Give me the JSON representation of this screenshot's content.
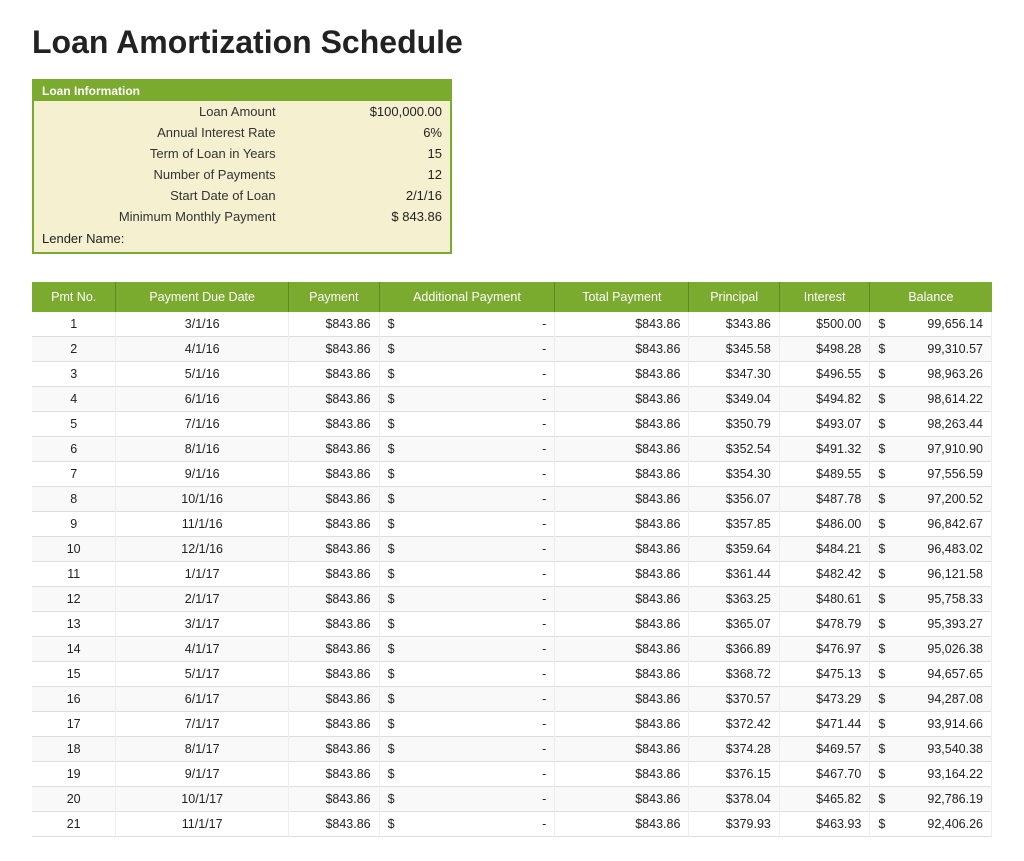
{
  "title": "Loan Amortization Schedule",
  "loanInfo": {
    "header": "Loan Information",
    "fields": [
      {
        "label": "Loan Amount",
        "value": "$100,000.00"
      },
      {
        "label": "Annual Interest Rate",
        "value": "6%"
      },
      {
        "label": "Term of Loan in Years",
        "value": "15"
      },
      {
        "label": "Number of Payments",
        "value": "12"
      },
      {
        "label": "Start Date of Loan",
        "value": "2/1/16"
      },
      {
        "label": "Minimum Monthly Payment",
        "value": "$ 843.86"
      }
    ],
    "lenderLabel": "Lender Name:"
  },
  "tableHeaders": [
    "Pmt No.",
    "Payment Due Date",
    "Payment",
    "Additional Payment",
    "Total Payment",
    "Principal",
    "Interest",
    "Balance"
  ],
  "rows": [
    {
      "pmt": 1,
      "date": "3/1/16",
      "payment": "$843.86",
      "addlDollar": "$",
      "addlAmt": "-",
      "totalPayment": "$843.86",
      "principal": "$343.86",
      "interest": "$500.00",
      "balDollar": "$",
      "balance": "99,656.14"
    },
    {
      "pmt": 2,
      "date": "4/1/16",
      "payment": "$843.86",
      "addlDollar": "$",
      "addlAmt": "-",
      "totalPayment": "$843.86",
      "principal": "$345.58",
      "interest": "$498.28",
      "balDollar": "$",
      "balance": "99,310.57"
    },
    {
      "pmt": 3,
      "date": "5/1/16",
      "payment": "$843.86",
      "addlDollar": "$",
      "addlAmt": "-",
      "totalPayment": "$843.86",
      "principal": "$347.30",
      "interest": "$496.55",
      "balDollar": "$",
      "balance": "98,963.26"
    },
    {
      "pmt": 4,
      "date": "6/1/16",
      "payment": "$843.86",
      "addlDollar": "$",
      "addlAmt": "-",
      "totalPayment": "$843.86",
      "principal": "$349.04",
      "interest": "$494.82",
      "balDollar": "$",
      "balance": "98,614.22"
    },
    {
      "pmt": 5,
      "date": "7/1/16",
      "payment": "$843.86",
      "addlDollar": "$",
      "addlAmt": "-",
      "totalPayment": "$843.86",
      "principal": "$350.79",
      "interest": "$493.07",
      "balDollar": "$",
      "balance": "98,263.44"
    },
    {
      "pmt": 6,
      "date": "8/1/16",
      "payment": "$843.86",
      "addlDollar": "$",
      "addlAmt": "-",
      "totalPayment": "$843.86",
      "principal": "$352.54",
      "interest": "$491.32",
      "balDollar": "$",
      "balance": "97,910.90"
    },
    {
      "pmt": 7,
      "date": "9/1/16",
      "payment": "$843.86",
      "addlDollar": "$",
      "addlAmt": "-",
      "totalPayment": "$843.86",
      "principal": "$354.30",
      "interest": "$489.55",
      "balDollar": "$",
      "balance": "97,556.59"
    },
    {
      "pmt": 8,
      "date": "10/1/16",
      "payment": "$843.86",
      "addlDollar": "$",
      "addlAmt": "-",
      "totalPayment": "$843.86",
      "principal": "$356.07",
      "interest": "$487.78",
      "balDollar": "$",
      "balance": "97,200.52"
    },
    {
      "pmt": 9,
      "date": "11/1/16",
      "payment": "$843.86",
      "addlDollar": "$",
      "addlAmt": "-",
      "totalPayment": "$843.86",
      "principal": "$357.85",
      "interest": "$486.00",
      "balDollar": "$",
      "balance": "96,842.67"
    },
    {
      "pmt": 10,
      "date": "12/1/16",
      "payment": "$843.86",
      "addlDollar": "$",
      "addlAmt": "-",
      "totalPayment": "$843.86",
      "principal": "$359.64",
      "interest": "$484.21",
      "balDollar": "$",
      "balance": "96,483.02"
    },
    {
      "pmt": 11,
      "date": "1/1/17",
      "payment": "$843.86",
      "addlDollar": "$",
      "addlAmt": "-",
      "totalPayment": "$843.86",
      "principal": "$361.44",
      "interest": "$482.42",
      "balDollar": "$",
      "balance": "96,121.58"
    },
    {
      "pmt": 12,
      "date": "2/1/17",
      "payment": "$843.86",
      "addlDollar": "$",
      "addlAmt": "-",
      "totalPayment": "$843.86",
      "principal": "$363.25",
      "interest": "$480.61",
      "balDollar": "$",
      "balance": "95,758.33"
    },
    {
      "pmt": 13,
      "date": "3/1/17",
      "payment": "$843.86",
      "addlDollar": "$",
      "addlAmt": "-",
      "totalPayment": "$843.86",
      "principal": "$365.07",
      "interest": "$478.79",
      "balDollar": "$",
      "balance": "95,393.27"
    },
    {
      "pmt": 14,
      "date": "4/1/17",
      "payment": "$843.86",
      "addlDollar": "$",
      "addlAmt": "-",
      "totalPayment": "$843.86",
      "principal": "$366.89",
      "interest": "$476.97",
      "balDollar": "$",
      "balance": "95,026.38"
    },
    {
      "pmt": 15,
      "date": "5/1/17",
      "payment": "$843.86",
      "addlDollar": "$",
      "addlAmt": "-",
      "totalPayment": "$843.86",
      "principal": "$368.72",
      "interest": "$475.13",
      "balDollar": "$",
      "balance": "94,657.65"
    },
    {
      "pmt": 16,
      "date": "6/1/17",
      "payment": "$843.86",
      "addlDollar": "$",
      "addlAmt": "-",
      "totalPayment": "$843.86",
      "principal": "$370.57",
      "interest": "$473.29",
      "balDollar": "$",
      "balance": "94,287.08"
    },
    {
      "pmt": 17,
      "date": "7/1/17",
      "payment": "$843.86",
      "addlDollar": "$",
      "addlAmt": "-",
      "totalPayment": "$843.86",
      "principal": "$372.42",
      "interest": "$471.44",
      "balDollar": "$",
      "balance": "93,914.66"
    },
    {
      "pmt": 18,
      "date": "8/1/17",
      "payment": "$843.86",
      "addlDollar": "$",
      "addlAmt": "-",
      "totalPayment": "$843.86",
      "principal": "$374.28",
      "interest": "$469.57",
      "balDollar": "$",
      "balance": "93,540.38"
    },
    {
      "pmt": 19,
      "date": "9/1/17",
      "payment": "$843.86",
      "addlDollar": "$",
      "addlAmt": "-",
      "totalPayment": "$843.86",
      "principal": "$376.15",
      "interest": "$467.70",
      "balDollar": "$",
      "balance": "93,164.22"
    },
    {
      "pmt": 20,
      "date": "10/1/17",
      "payment": "$843.86",
      "addlDollar": "$",
      "addlAmt": "-",
      "totalPayment": "$843.86",
      "principal": "$378.04",
      "interest": "$465.82",
      "balDollar": "$",
      "balance": "92,786.19"
    },
    {
      "pmt": 21,
      "date": "11/1/17",
      "payment": "$843.86",
      "addlDollar": "$",
      "addlAmt": "-",
      "totalPayment": "$843.86",
      "principal": "$379.93",
      "interest": "$463.93",
      "balDollar": "$",
      "balance": "92,406.26"
    }
  ]
}
